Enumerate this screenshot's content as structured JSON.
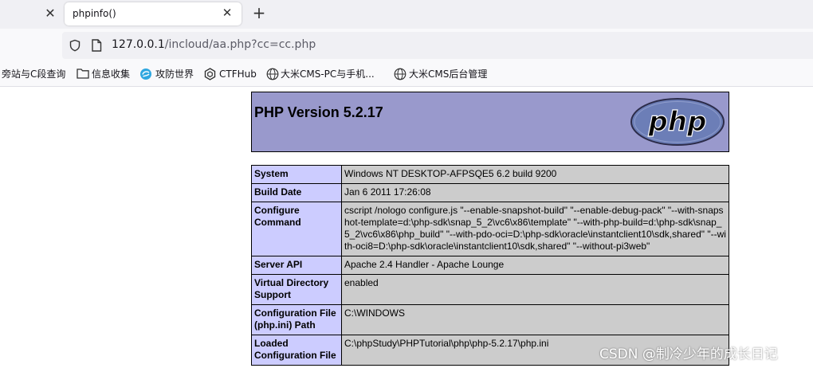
{
  "tabs": {
    "previous_close": "✕",
    "active_title": "phpinfo()",
    "active_close": "✕",
    "new_tab": "+"
  },
  "url": {
    "host": "127.0.0.1",
    "path": "/incloud/aa.php?cc=cc.php",
    "icons": [
      "shield-icon",
      "page-icon"
    ]
  },
  "bookmarks": [
    {
      "label": "旁站与C段查询",
      "icon": "none"
    },
    {
      "label": "信息收集",
      "icon": "folder-icon"
    },
    {
      "label": "攻防世界",
      "icon": "site-logo-icon"
    },
    {
      "label": "CTFHub",
      "icon": "ctfhub-icon"
    },
    {
      "label": "大米CMS-PC与手机...",
      "icon": "globe-icon"
    },
    {
      "label": "大米CMS后台管理",
      "icon": "globe-icon"
    }
  ],
  "phpinfo": {
    "title": "PHP Version 5.2.17",
    "logo_text": "php",
    "rows": [
      {
        "key": "System",
        "value": "Windows NT DESKTOP-AFPSQE5 6.2 build 9200"
      },
      {
        "key": "Build Date",
        "value": "Jan 6 2011 17:26:08"
      },
      {
        "key": "Configure Command",
        "value": "cscript /nologo configure.js \"--enable-snapshot-build\" \"--enable-debug-pack\" \"--with-snapshot-template=d:\\php-sdk\\snap_5_2\\vc6\\x86\\template\" \"--with-php-build=d:\\php-sdk\\snap_5_2\\vc6\\x86\\php_build\" \"--with-pdo-oci=D:\\php-sdk\\oracle\\instantclient10\\sdk,shared\" \"--with-oci8=D:\\php-sdk\\oracle\\instantclient10\\sdk,shared\" \"--without-pi3web\""
      },
      {
        "key": "Server API",
        "value": "Apache 2.4 Handler - Apache Lounge"
      },
      {
        "key": "Virtual Directory Support",
        "value": "enabled"
      },
      {
        "key": "Configuration File (php.ini) Path",
        "value": "C:\\WINDOWS"
      },
      {
        "key": "Loaded Configuration File",
        "value": "C:\\phpStudy\\PHPTutorial\\php\\php-5.2.17\\php.ini"
      }
    ]
  },
  "watermark": "CSDN @制冷少年的成长日记",
  "colors": {
    "header_bg": "#9999cc",
    "key_bg": "#ccccff",
    "value_bg": "#cccccc"
  }
}
